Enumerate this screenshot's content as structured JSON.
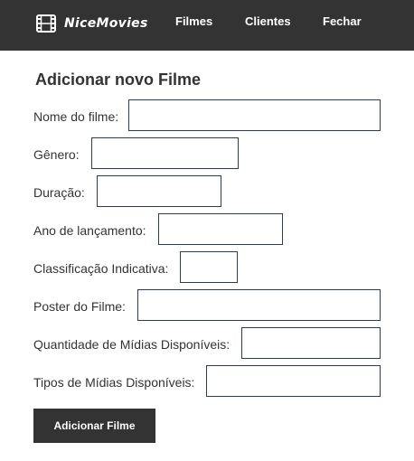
{
  "navbar": {
    "brand": "NiceMovies",
    "brand_icon": "film-icon",
    "links": [
      "Filmes",
      "Clientes",
      "Fechar"
    ],
    "background": "#333333"
  },
  "form": {
    "title": "Adicionar novo Filme",
    "fields": [
      {
        "label": "Nome do filme:",
        "value": ""
      },
      {
        "label": "Gênero:",
        "value": ""
      },
      {
        "label": "Duração:",
        "value": ""
      },
      {
        "label": "Ano de lançamento:",
        "value": ""
      },
      {
        "label": "Classificação Indicativa:",
        "value": ""
      },
      {
        "label": "Poster do Filme:",
        "value": ""
      },
      {
        "label": "Quantidade de Mídias Disponíveis:",
        "value": ""
      },
      {
        "label": "Tipos de Mídias Disponíveis:",
        "value": ""
      }
    ],
    "submit_label": "Adicionar Filme"
  }
}
